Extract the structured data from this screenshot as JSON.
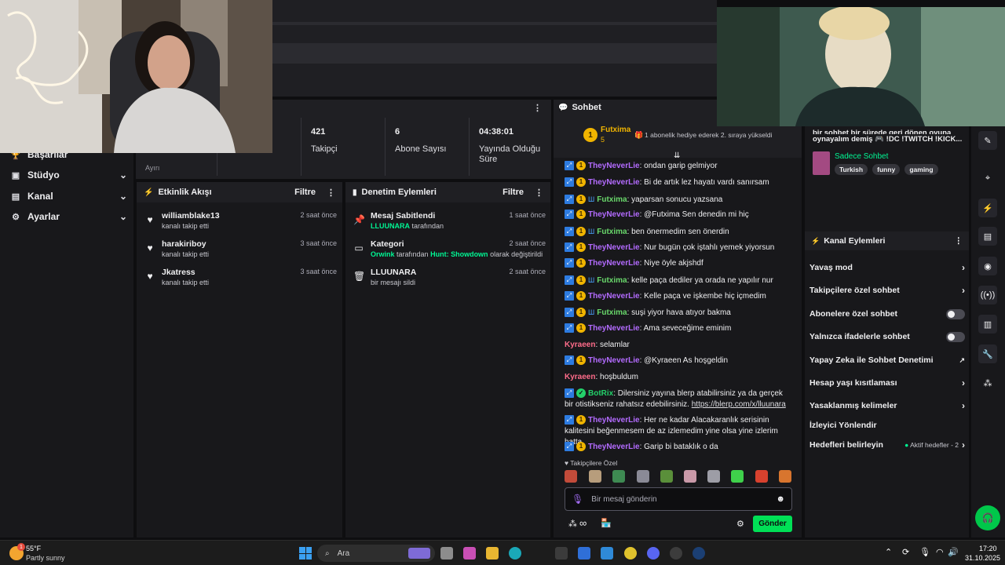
{
  "sidebar": {
    "items": [
      {
        "label": "Başarılar",
        "icon": "trophy-icon"
      },
      {
        "label": "Stüdyo",
        "icon": "studio-icon"
      },
      {
        "label": "Kanal",
        "icon": "channel-icon"
      },
      {
        "label": "Ayarlar",
        "icon": "gear-icon"
      }
    ],
    "partial_label": "Ayırı"
  },
  "stats": [
    {
      "value": "421",
      "label": "Takipçi"
    },
    {
      "value": "6",
      "label": "Abone Sayısı"
    },
    {
      "value": "04:38:01",
      "label": "Yayında Olduğu Süre"
    }
  ],
  "activity": {
    "title": "Etkinlik Akışı",
    "filter_label": "Filtre",
    "events": [
      {
        "user": "williamblake13",
        "action": "kanalı takip etti",
        "time": "2 saat önce"
      },
      {
        "user": "harakiriboy",
        "action": "kanalı takip etti",
        "time": "3 saat önce"
      },
      {
        "user": "Jkatress",
        "action": "kanalı takip etti",
        "time": "3 saat önce"
      }
    ]
  },
  "moderation": {
    "title": "Denetim Eylemleri",
    "filter_label": "Filtre",
    "events": [
      {
        "title": "Mesaj Sabitlendi",
        "actor": "LLUUNARA",
        "detail": "tarafından",
        "time": "1 saat önce"
      },
      {
        "title": "Kategori",
        "actor": "Orwink",
        "detail_pre": "tarafından",
        "category": "Hunt: Showdown",
        "detail_post": "olarak değiştirildi",
        "time": "2 saat önce"
      },
      {
        "title": "LLUUNARA",
        "detail": "bir mesajı sildi",
        "time": "2 saat önce"
      }
    ]
  },
  "chat": {
    "title": "Sohbet",
    "pinned": {
      "user": "Futxima",
      "count": "5",
      "gift_text": "1 abonelik hediye ederek 2. sıraya yükseldi"
    },
    "messages": [
      {
        "user": "TheyNeverLie",
        "color": "purple",
        "text": ": ondan garip gelmiyor"
      },
      {
        "user": "TheyNeverLie",
        "color": "purple",
        "text": ": Bi de artık lez hayatı vardı sanırsam"
      },
      {
        "user": "Futxima",
        "color": "green",
        "text": ": yaparsan sonucu yazsana"
      },
      {
        "user": "TheyNeverLie",
        "color": "purple",
        "text": ": @Futxima Sen denedin mi hiç"
      },
      {
        "user": "Futxima",
        "color": "green",
        "text": ": ben önermedim sen önerdin"
      },
      {
        "user": "TheyNeverLie",
        "color": "purple",
        "text": ": Nur bugün çok iştahlı yemek yiyorsun"
      },
      {
        "user": "TheyNeverLie",
        "color": "purple",
        "text": ": Niye öyle akjshdf"
      },
      {
        "user": "Futxima",
        "color": "green",
        "text": ": kelle paça dediler ya orada ne yapılır nur"
      },
      {
        "user": "TheyNeverLie",
        "color": "purple",
        "text": ": Kelle paça ve işkembe hiç içmedim"
      },
      {
        "user": "Futxima",
        "color": "green",
        "text": ": suşi yiyor hava atıyor bakma"
      },
      {
        "user": "TheyNeverLie",
        "color": "purple",
        "text": ": Ama seveceğime eminim"
      },
      {
        "user": "Kyraeen",
        "color": "pink",
        "text": ": selamlar"
      },
      {
        "user": "TheyNeverLie",
        "color": "purple",
        "text": ": @Kyraeen As hoşgeldin"
      },
      {
        "user": "Kyraeen",
        "color": "pink",
        "text": ": hoşbuldum"
      },
      {
        "user": "BotRix",
        "color": "bot",
        "text": ": Dilersiniz yayına blerp atabilirsiniz ya da gerçek bir otistikseniz rahatsız edebilirsiniz. ",
        "link": "https://blerp.com/x/lluunara"
      },
      {
        "user": "TheyNeverLie",
        "color": "purple",
        "text": ": Her ne kadar Alacakaranlık serisinin kalitesini beğenmesem de az izlemedim yine olsa yine izlerim hatta"
      },
      {
        "user": "TheyNeverLie",
        "color": "purple",
        "text": ": Garip bi bataklık o da"
      }
    ],
    "followers_only_label": "Takipçilere Özel",
    "input_placeholder": "Bir mesaj gönderin",
    "send_label": "Gönder"
  },
  "stream_info": {
    "title_line1": "bir sohbet bir sürede geri dönen oyuna",
    "title_line2": "oynayalım demiş 🎮 !DC !TWITCH !KICK...",
    "mode": "Sadece Sohbet",
    "tags": [
      "Turkish",
      "funny",
      "gaming"
    ]
  },
  "channel_actions": {
    "title": "Kanal Eylemleri",
    "items": [
      {
        "label": "Yavaş mod",
        "control": "chevron"
      },
      {
        "label": "Takipçilere özel sohbet",
        "control": "chevron"
      },
      {
        "label": "Abonelere özel sohbet",
        "control": "toggle"
      },
      {
        "label": "Yalnızca ifadelerle sohbet",
        "control": "toggle"
      },
      {
        "label": "Yapay Zeka ile Sohbet Denetimi",
        "control": "external"
      },
      {
        "label": "Hesap yaşı kısıtlaması",
        "control": "chevron"
      },
      {
        "label": "Yasaklanmış kelimeler",
        "control": "chevron"
      },
      {
        "label": "İzleyici Yönlendir",
        "control": "none"
      },
      {
        "label": "Hedefleri belirleyin",
        "control": "goals"
      }
    ],
    "goals_status": "Aktif hedefler - 2"
  },
  "taskbar": {
    "weather_temp": "55°F",
    "weather_desc": "Partly sunny",
    "weather_badge": "1",
    "search_label": "Ara",
    "time": "17:20",
    "date": "31.10.2025"
  }
}
